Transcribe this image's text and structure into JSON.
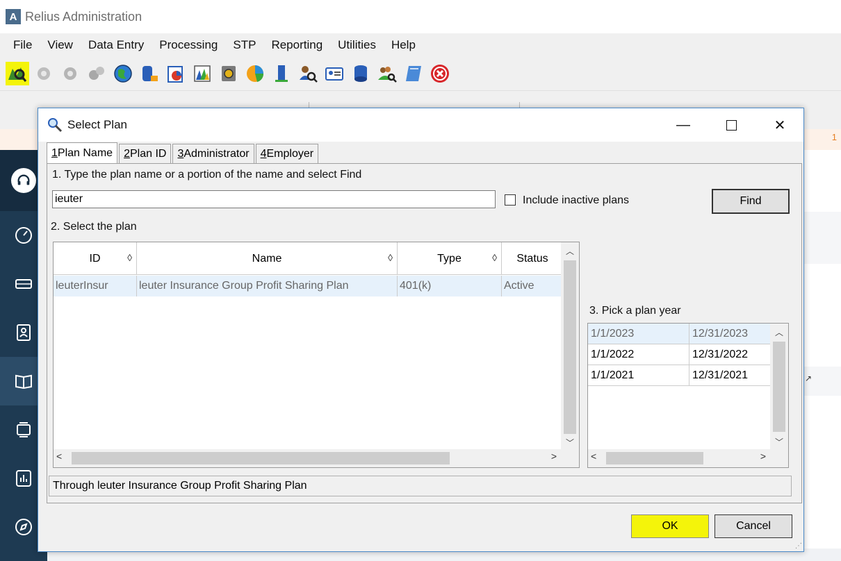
{
  "app": {
    "title": "Relius Administration",
    "logo_letter": "A"
  },
  "menu": [
    "File",
    "View",
    "Data Entry",
    "Processing",
    "STP",
    "Reporting",
    "Utilities",
    "Help"
  ],
  "background": {
    "right_text": "1"
  },
  "dialog": {
    "title": "Select Plan",
    "tabs": [
      {
        "key": "1",
        "label": " Plan Name"
      },
      {
        "key": "2",
        "label": " Plan ID"
      },
      {
        "key": "3",
        "label": " Administrator"
      },
      {
        "key": "4",
        "label": " Employer"
      }
    ],
    "step1_label": "1. Type the plan name or a portion of the name and select Find",
    "search_value": "ieuter",
    "include_inactive_label": "Include inactive plans",
    "find_label": "Find",
    "step2_label": "2. Select the plan",
    "plan_columns": [
      "ID",
      "Name",
      "Type",
      "Status"
    ],
    "plan_rows": [
      {
        "id": "leuterInsur",
        "name": "leuter Insurance Group Profit Sharing Plan",
        "type": "401(k)",
        "status": "Active"
      }
    ],
    "step3_label": "3. Pick a plan year",
    "plan_years": [
      {
        "start": "1/1/2023",
        "end": "12/31/2023"
      },
      {
        "start": "1/1/2022",
        "end": "12/31/2022"
      },
      {
        "start": "1/1/2021",
        "end": "12/31/2021"
      }
    ],
    "status_text": "Through leuter Insurance Group Profit Sharing Plan",
    "ok_label": "OK",
    "cancel_label": "Cancel"
  },
  "colors": {
    "highlight": "#f4f40a",
    "sidebar": "#1e3a52",
    "selection": "#e6f1fb"
  }
}
